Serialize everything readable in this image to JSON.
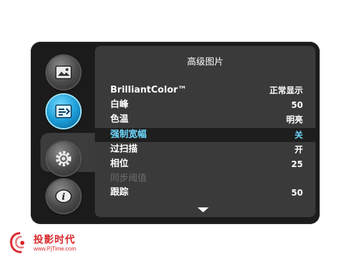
{
  "sidebar": {
    "items": [
      {
        "name": "picture-icon"
      },
      {
        "name": "advanced-picture-icon",
        "active": true
      },
      {
        "name": "settings-gear-icon"
      },
      {
        "name": "info-icon"
      }
    ]
  },
  "panel": {
    "title": "高级图片",
    "rows": [
      {
        "label": "BrilliantColor™",
        "value": "正常显示"
      },
      {
        "label": "白峰",
        "value": "50"
      },
      {
        "label": "色温",
        "value": "明亮"
      },
      {
        "label": "强制宽幅",
        "value": "关"
      },
      {
        "label": "过扫描",
        "value": "开"
      },
      {
        "label": "相位",
        "value": "25"
      },
      {
        "label": "同步阈值",
        "value": ""
      },
      {
        "label": "跟踪",
        "value": "50"
      }
    ],
    "selected_index": 3,
    "disabled_index": 6
  },
  "watermark": {
    "brand": "投影时代",
    "url": "www.PjTime.com"
  },
  "colors": {
    "accent": "#6fd8ff",
    "brand_red": "#d9262a"
  }
}
